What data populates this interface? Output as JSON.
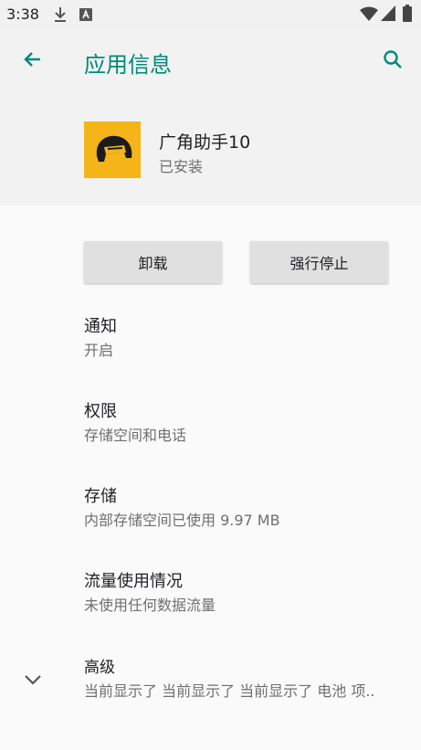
{
  "status_bar": {
    "time": "3:38",
    "icons": [
      "download-icon",
      "text-badge-icon",
      "wifi-icon",
      "signal-icon",
      "battery-icon"
    ]
  },
  "app_bar": {
    "title": "应用信息",
    "back_icon": "arrow-back-icon",
    "search_icon": "search-icon",
    "accent_color": "#00897b"
  },
  "app_header": {
    "name": "广角助手10",
    "status": "已安装",
    "icon_color": "#f5b418"
  },
  "actions": {
    "uninstall": "卸载",
    "force_stop": "强行停止"
  },
  "settings": [
    {
      "title": "通知",
      "summary": "开启"
    },
    {
      "title": "权限",
      "summary": "存储空间和电话"
    },
    {
      "title": "存储",
      "summary": "内部存储空间已使用 9.97 MB"
    },
    {
      "title": "流量使用情况",
      "summary": "未使用任何数据流量"
    },
    {
      "title": "高级",
      "summary": "当前显示了 当前显示了 当前显示了 电池 项.."
    }
  ]
}
